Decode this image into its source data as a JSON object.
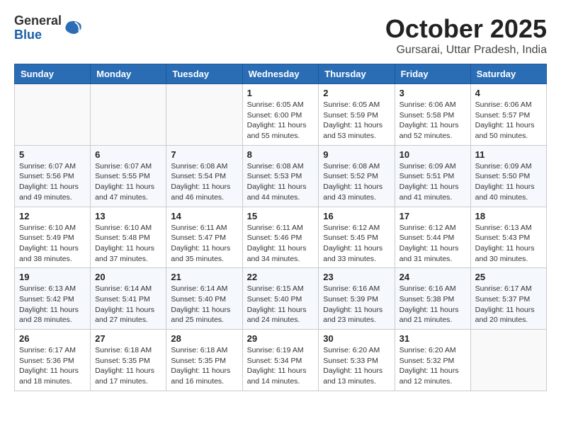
{
  "header": {
    "logo_general": "General",
    "logo_blue": "Blue",
    "month": "October 2025",
    "location": "Gursarai, Uttar Pradesh, India"
  },
  "weekdays": [
    "Sunday",
    "Monday",
    "Tuesday",
    "Wednesday",
    "Thursday",
    "Friday",
    "Saturday"
  ],
  "weeks": [
    [
      {
        "day": "",
        "info": ""
      },
      {
        "day": "",
        "info": ""
      },
      {
        "day": "",
        "info": ""
      },
      {
        "day": "1",
        "info": "Sunrise: 6:05 AM\nSunset: 6:00 PM\nDaylight: 11 hours\nand 55 minutes."
      },
      {
        "day": "2",
        "info": "Sunrise: 6:05 AM\nSunset: 5:59 PM\nDaylight: 11 hours\nand 53 minutes."
      },
      {
        "day": "3",
        "info": "Sunrise: 6:06 AM\nSunset: 5:58 PM\nDaylight: 11 hours\nand 52 minutes."
      },
      {
        "day": "4",
        "info": "Sunrise: 6:06 AM\nSunset: 5:57 PM\nDaylight: 11 hours\nand 50 minutes."
      }
    ],
    [
      {
        "day": "5",
        "info": "Sunrise: 6:07 AM\nSunset: 5:56 PM\nDaylight: 11 hours\nand 49 minutes."
      },
      {
        "day": "6",
        "info": "Sunrise: 6:07 AM\nSunset: 5:55 PM\nDaylight: 11 hours\nand 47 minutes."
      },
      {
        "day": "7",
        "info": "Sunrise: 6:08 AM\nSunset: 5:54 PM\nDaylight: 11 hours\nand 46 minutes."
      },
      {
        "day": "8",
        "info": "Sunrise: 6:08 AM\nSunset: 5:53 PM\nDaylight: 11 hours\nand 44 minutes."
      },
      {
        "day": "9",
        "info": "Sunrise: 6:08 AM\nSunset: 5:52 PM\nDaylight: 11 hours\nand 43 minutes."
      },
      {
        "day": "10",
        "info": "Sunrise: 6:09 AM\nSunset: 5:51 PM\nDaylight: 11 hours\nand 41 minutes."
      },
      {
        "day": "11",
        "info": "Sunrise: 6:09 AM\nSunset: 5:50 PM\nDaylight: 11 hours\nand 40 minutes."
      }
    ],
    [
      {
        "day": "12",
        "info": "Sunrise: 6:10 AM\nSunset: 5:49 PM\nDaylight: 11 hours\nand 38 minutes."
      },
      {
        "day": "13",
        "info": "Sunrise: 6:10 AM\nSunset: 5:48 PM\nDaylight: 11 hours\nand 37 minutes."
      },
      {
        "day": "14",
        "info": "Sunrise: 6:11 AM\nSunset: 5:47 PM\nDaylight: 11 hours\nand 35 minutes."
      },
      {
        "day": "15",
        "info": "Sunrise: 6:11 AM\nSunset: 5:46 PM\nDaylight: 11 hours\nand 34 minutes."
      },
      {
        "day": "16",
        "info": "Sunrise: 6:12 AM\nSunset: 5:45 PM\nDaylight: 11 hours\nand 33 minutes."
      },
      {
        "day": "17",
        "info": "Sunrise: 6:12 AM\nSunset: 5:44 PM\nDaylight: 11 hours\nand 31 minutes."
      },
      {
        "day": "18",
        "info": "Sunrise: 6:13 AM\nSunset: 5:43 PM\nDaylight: 11 hours\nand 30 minutes."
      }
    ],
    [
      {
        "day": "19",
        "info": "Sunrise: 6:13 AM\nSunset: 5:42 PM\nDaylight: 11 hours\nand 28 minutes."
      },
      {
        "day": "20",
        "info": "Sunrise: 6:14 AM\nSunset: 5:41 PM\nDaylight: 11 hours\nand 27 minutes."
      },
      {
        "day": "21",
        "info": "Sunrise: 6:14 AM\nSunset: 5:40 PM\nDaylight: 11 hours\nand 25 minutes."
      },
      {
        "day": "22",
        "info": "Sunrise: 6:15 AM\nSunset: 5:40 PM\nDaylight: 11 hours\nand 24 minutes."
      },
      {
        "day": "23",
        "info": "Sunrise: 6:16 AM\nSunset: 5:39 PM\nDaylight: 11 hours\nand 23 minutes."
      },
      {
        "day": "24",
        "info": "Sunrise: 6:16 AM\nSunset: 5:38 PM\nDaylight: 11 hours\nand 21 minutes."
      },
      {
        "day": "25",
        "info": "Sunrise: 6:17 AM\nSunset: 5:37 PM\nDaylight: 11 hours\nand 20 minutes."
      }
    ],
    [
      {
        "day": "26",
        "info": "Sunrise: 6:17 AM\nSunset: 5:36 PM\nDaylight: 11 hours\nand 18 minutes."
      },
      {
        "day": "27",
        "info": "Sunrise: 6:18 AM\nSunset: 5:35 PM\nDaylight: 11 hours\nand 17 minutes."
      },
      {
        "day": "28",
        "info": "Sunrise: 6:18 AM\nSunset: 5:35 PM\nDaylight: 11 hours\nand 16 minutes."
      },
      {
        "day": "29",
        "info": "Sunrise: 6:19 AM\nSunset: 5:34 PM\nDaylight: 11 hours\nand 14 minutes."
      },
      {
        "day": "30",
        "info": "Sunrise: 6:20 AM\nSunset: 5:33 PM\nDaylight: 11 hours\nand 13 minutes."
      },
      {
        "day": "31",
        "info": "Sunrise: 6:20 AM\nSunset: 5:32 PM\nDaylight: 11 hours\nand 12 minutes."
      },
      {
        "day": "",
        "info": ""
      }
    ]
  ]
}
